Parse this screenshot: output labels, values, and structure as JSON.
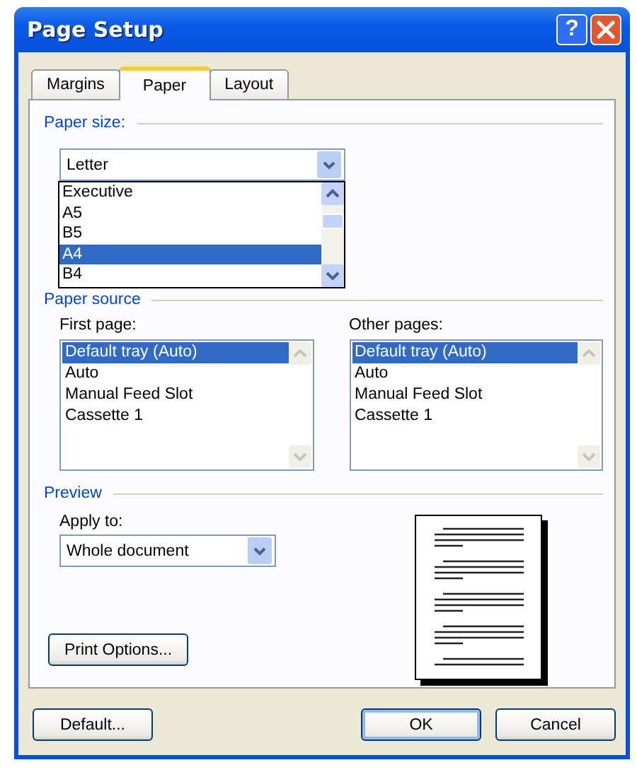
{
  "window": {
    "title": "Page Setup"
  },
  "help_button": {
    "label": "?"
  },
  "tabs": [
    {
      "label": "Margins",
      "selected": false
    },
    {
      "label": "Paper",
      "selected": true
    },
    {
      "label": "Layout",
      "selected": false
    }
  ],
  "paper_size": {
    "heading": "Paper size:",
    "value": "Letter",
    "expanded": true,
    "options": [
      {
        "label": "Executive",
        "selected": false
      },
      {
        "label": "A5",
        "selected": false
      },
      {
        "label": "B5",
        "selected": false
      },
      {
        "label": "A4",
        "selected": true
      },
      {
        "label": "B4",
        "selected": false
      }
    ]
  },
  "paper_source": {
    "heading": "Paper source",
    "lists": [
      {
        "label": "First page:",
        "items": [
          {
            "label": "Default tray (Auto)",
            "selected": true
          },
          {
            "label": "Auto",
            "selected": false
          },
          {
            "label": "Manual Feed Slot",
            "selected": false
          },
          {
            "label": "Cassette 1",
            "selected": false
          }
        ]
      },
      {
        "label": "Other pages:",
        "items": [
          {
            "label": "Default tray (Auto)",
            "selected": true
          },
          {
            "label": "Auto",
            "selected": false
          },
          {
            "label": "Manual Feed Slot",
            "selected": false
          },
          {
            "label": "Cassette 1",
            "selected": false
          }
        ]
      }
    ]
  },
  "preview": {
    "heading": "Preview",
    "apply_to": {
      "label": "Apply to:",
      "value": "Whole document"
    },
    "print_options_button": {
      "label": "Print Options..."
    }
  },
  "buttons": [
    {
      "label": "Default...",
      "default": false
    },
    {
      "label": "OK",
      "default": true
    },
    {
      "label": "Cancel",
      "default": false
    }
  ]
}
